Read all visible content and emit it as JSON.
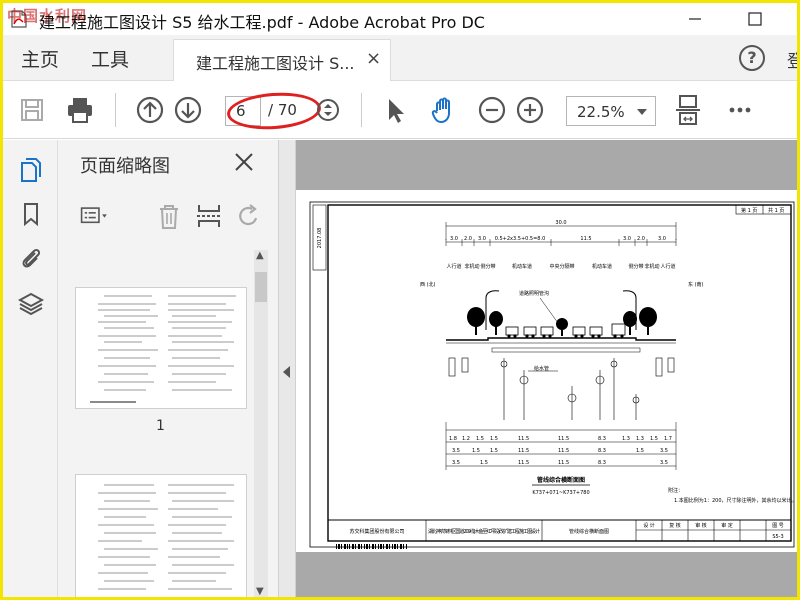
{
  "window": {
    "title": "建工程施工图设计 S5 给水工程.pdf - Adobe Acrobat Pro DC",
    "watermark": "中国水利网",
    "minimize_icon": "minimize-icon",
    "maximize_icon": "maximize-icon"
  },
  "menu": {
    "home": "主页",
    "tools": "工具",
    "doc_tab": "建工程施工图设计 S...",
    "doc_tab_close": "×",
    "help": "?",
    "signin": "登"
  },
  "toolbar": {
    "current_page": "6",
    "page_total": "/ 70",
    "zoom": "22.5%",
    "icons": [
      "save-icon",
      "print-icon",
      "prev-page-icon",
      "next-page-icon",
      "page-stepper-icon",
      "select-cursor-icon",
      "hand-tool-icon",
      "zoom-out-icon",
      "zoom-in-icon",
      "scroll-mode-icon",
      "more-icon"
    ],
    "highlight_color": "#e02020"
  },
  "sidebar": {
    "icons": [
      "page-thumbnails-icon",
      "bookmark-icon",
      "attachment-icon",
      "layers-icon"
    ],
    "active_color": "#1a73c8"
  },
  "thumb_panel": {
    "title": "页面缩略图",
    "tool_icons": [
      "thumbnail-options-icon",
      "delete-page-icon",
      "insert-page-icon",
      "rotate-page-icon"
    ],
    "thumbnails": [
      {
        "label": "1"
      },
      {
        "label": ""
      }
    ]
  },
  "drawing": {
    "stamp_left": "2017.08",
    "total_width": "30.0",
    "road_segments": [
      "3.0",
      "2.0",
      "3.0",
      "0.5+2x3.5+0.5=8.0",
      "11.5",
      "3.0",
      "2.0",
      "3.0"
    ],
    "lane_labels": [
      "人行道",
      "非机动",
      "侧分带",
      "机动车道",
      "中央分隔带",
      "机动车道",
      "侧分带",
      "非机动",
      "人行道"
    ],
    "direction_left": "西 (北)",
    "direction_right": "东 (南)",
    "pipe_label": "道路照明管沟",
    "water_main_label": "给水管",
    "dim_rows": [
      [
        "1.8",
        "1.2",
        "1.5",
        "1.5",
        "11.5",
        "11.5",
        "8.3",
        "1.3",
        "1.3",
        "1.5",
        "1.7"
      ],
      [
        "3.5",
        "1.5",
        "1.5",
        "11.5",
        "11.5",
        "8.3",
        "1.5",
        "3.5"
      ],
      [
        "3.5",
        "1.5",
        "11.5",
        "11.5",
        "8.3",
        "3.5"
      ]
    ],
    "section_title": "管线综合横断面图",
    "station": "K737+071~K737+780",
    "note_title": "附注：",
    "note": "1.本图比例为1：200，尺寸除注明外，其余均以米计。",
    "sheet_no": "第 1 页",
    "sheet_total": "共 1 页",
    "company": "苏交科集团股份有限公司",
    "project": "湖北神农架林区国道209线(木鱼至红坪段)改扩建工程 施工图设计",
    "drawing_name": "管线综合横断面图",
    "sign_headers": [
      "设 计",
      "复 核",
      "审 核",
      "审 定",
      "图 号"
    ],
    "drawing_no": "S5-3"
  }
}
